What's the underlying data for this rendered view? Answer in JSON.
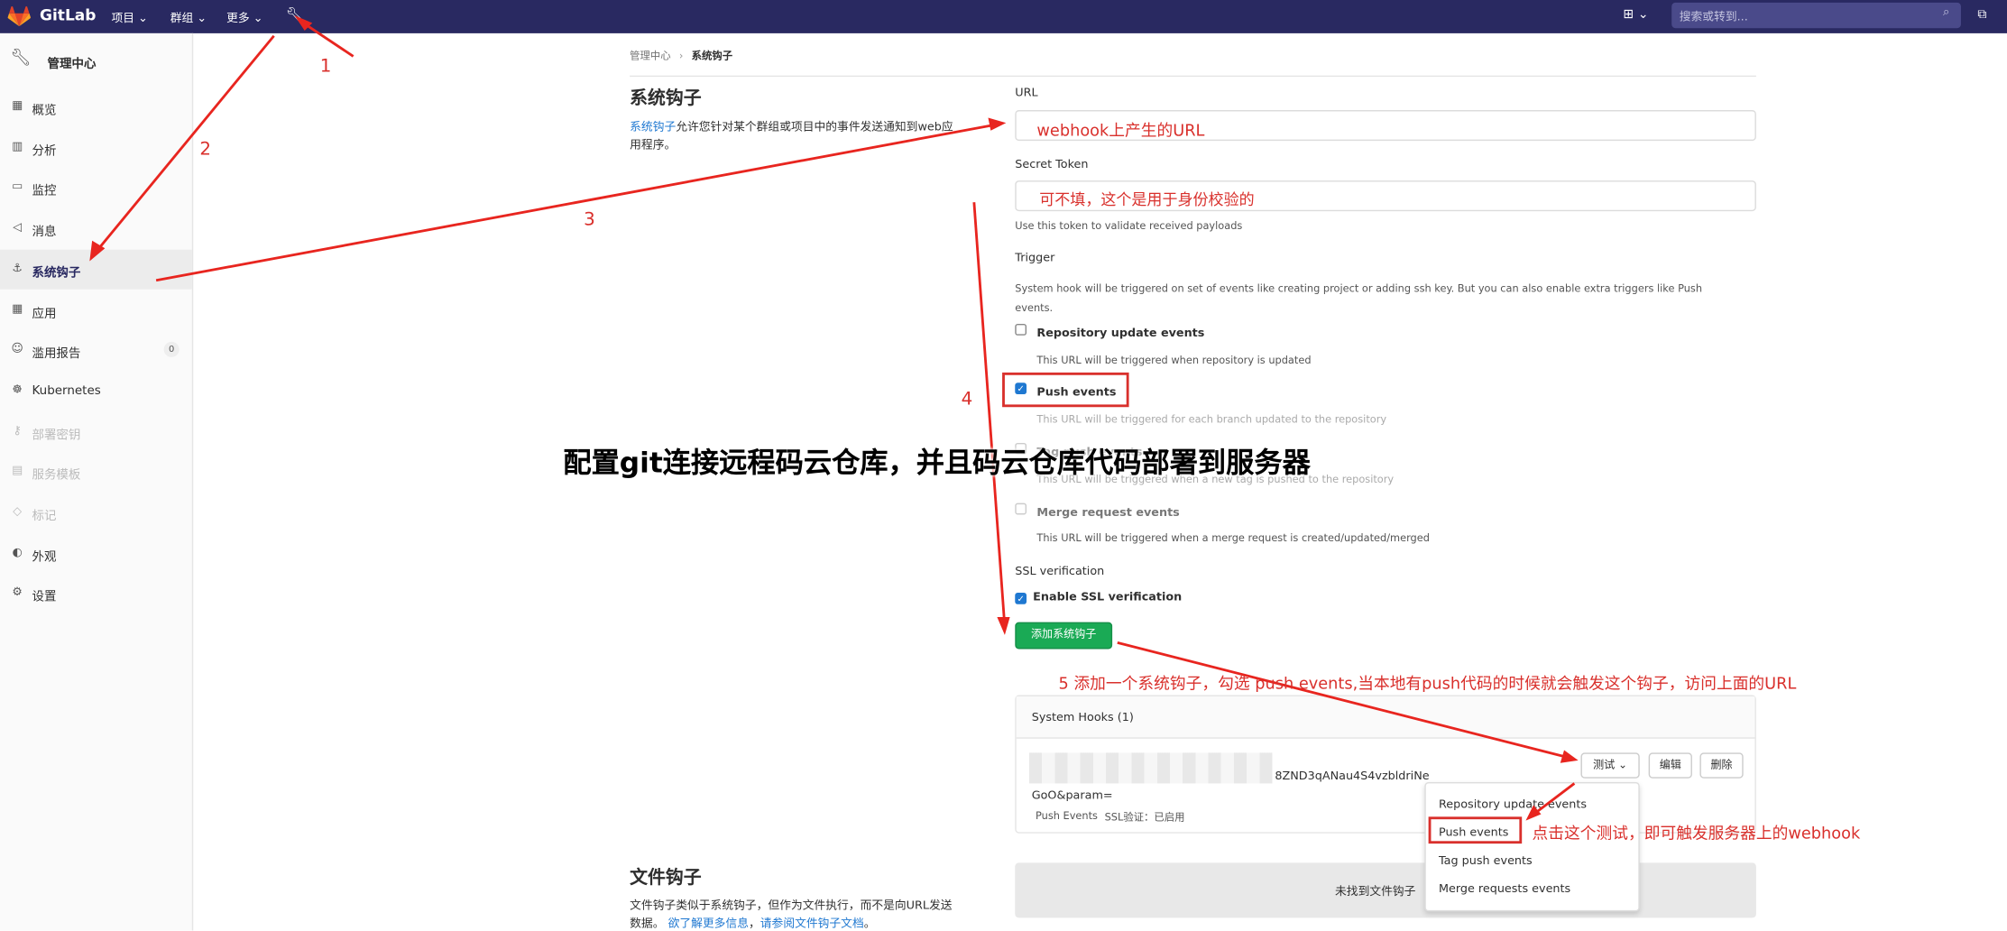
{
  "topnav": {
    "brand": "GitLab",
    "projects": "项目",
    "groups": "群组",
    "more": "更多",
    "search_placeholder": "搜索或转到..."
  },
  "sidebar": {
    "header": "管理中心",
    "items": [
      {
        "label": "概览",
        "icon": "overview-icon"
      },
      {
        "label": "分析",
        "icon": "analytics-icon"
      },
      {
        "label": "监控",
        "icon": "monitoring-icon"
      },
      {
        "label": "消息",
        "icon": "messages-icon"
      },
      {
        "label": "系统钩子",
        "icon": "hook-icon"
      },
      {
        "label": "应用",
        "icon": "applications-icon"
      },
      {
        "label": "滥用报告",
        "icon": "abuse-report-icon",
        "badge": "0"
      },
      {
        "label": "Kubernetes",
        "icon": "kubernetes-icon"
      },
      {
        "label": "部署密钥",
        "icon": "key-icon"
      },
      {
        "label": "服务模板",
        "icon": "template-icon"
      },
      {
        "label": "标记",
        "icon": "label-icon"
      },
      {
        "label": "外观",
        "icon": "appearance-icon"
      },
      {
        "label": "设置",
        "icon": "settings-icon"
      }
    ]
  },
  "breadcrumb": {
    "root": "管理中心",
    "current": "系统钩子"
  },
  "left": {
    "title": "系统钩子",
    "desc_link": "系统钩子",
    "desc_rest": "允许您针对某个群组或项目中的事件发送通知到web应",
    "desc_line2": "用程序。"
  },
  "form": {
    "url_label": "URL",
    "url_value": "webhook上产生的URL",
    "token_label": "Secret Token",
    "token_value": "可不填，这个是用于身份校验的",
    "token_help": "Use this token to validate received payloads",
    "trigger_label": "Trigger",
    "trigger_desc1": "System hook will be triggered on set of events like creating project or adding ssh key. But you can also enable extra triggers like Push",
    "trigger_desc2": "events.",
    "events": [
      {
        "label": "Repository update events",
        "help": "This URL will be triggered when repository is updated",
        "checked": false
      },
      {
        "label": "Push events",
        "help": "This URL will be triggered for each branch updated to the repository",
        "checked": true
      },
      {
        "label": "Tag push events",
        "help": "This URL will be triggered when a new tag is pushed to the repository",
        "checked": false
      },
      {
        "label": "Merge request events",
        "help": "This URL will be triggered when a merge request is created/updated/merged",
        "checked": false
      }
    ],
    "ssl_label": "SSL verification",
    "ssl_check": "Enable SSL verification",
    "add_button": "添加系统钩子"
  },
  "hooks": {
    "title": "System Hooks (1)",
    "line1": "8ZND3qANau4S4vzbldriNe",
    "line2": "GoO&param=",
    "meta_events": "Push Events",
    "meta_ssl": "SSL验证：已启用",
    "test_button": "测试",
    "edit_button": "编辑",
    "delete_button": "删除",
    "dropdown": [
      "Repository update events",
      "Push events",
      "Tag push events",
      "Merge requests events"
    ]
  },
  "file_hooks": {
    "title": "文件钩子",
    "desc1": "文件钩子类似于系统钩子，但作为文件执行，而不是向URL发送",
    "desc2_a": "数据。",
    "link1": "欲了解更多信息",
    "sep": "，",
    "link2": "请参阅文件钩子文档",
    "end": "。",
    "empty": "未找到文件钩子"
  },
  "annotations": {
    "n1": "1",
    "n2": "2",
    "n3": "3",
    "n4": "4",
    "step5": "5 添加一个系统钩子，勾选 push events,当本地有push代码的时候就会触发这个钩子，访问上面的URL",
    "click_tip": "点击这个测试，即可触发服务器上的webhook",
    "overlay": "配置git连接远程码云仓库，并且码云仓库代码部署到服务器"
  },
  "colors": {
    "nav": "#292961",
    "green": "#1aaa55",
    "link": "#1f78d1",
    "annotation": "#d9302c"
  }
}
